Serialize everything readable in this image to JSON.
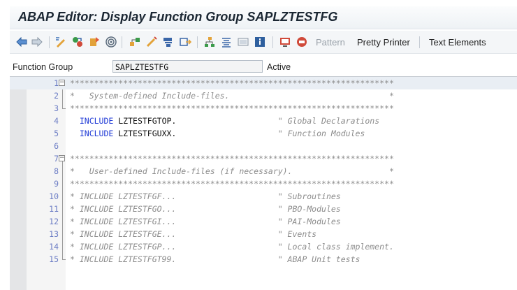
{
  "window": {
    "title": "ABAP Editor: Display Function Group SAPLZTESTFG"
  },
  "toolbar": {
    "icons": [
      "back-icon",
      "forward-icon",
      "other-object-icon",
      "display-change-icon",
      "activate-icon",
      "check-icon",
      "where-used-icon",
      "object-list-icon",
      "navigation-window-icon",
      "enhance-icon",
      "hierarchy-icon",
      "pretty-print-icon",
      "help-icon",
      "info-icon",
      "screen-icon",
      "test-icon"
    ],
    "pattern_label": "Pattern",
    "pretty_printer_label": "Pretty Printer",
    "text_elements_label": "Text Elements"
  },
  "header": {
    "field_label": "Function Group",
    "field_value": "SAPLZTESTFG",
    "status": "Active"
  },
  "editor": {
    "lines": [
      {
        "num": "1",
        "code": "*******************************************************************"
      },
      {
        "num": "2",
        "code": "*   System-defined Include-files.                                 *"
      },
      {
        "num": "3",
        "code": "*******************************************************************"
      },
      {
        "num": "4",
        "code": "  INCLUDE LZTESTFGTOP.                     \" Global Declarations"
      },
      {
        "num": "5",
        "code": "  INCLUDE LZTESTFGUXX.                     \" Function Modules"
      },
      {
        "num": "6",
        "code": ""
      },
      {
        "num": "7",
        "code": "*******************************************************************"
      },
      {
        "num": "8",
        "code": "*   User-defined Include-files (if necessary).                    *"
      },
      {
        "num": "9",
        "code": "*******************************************************************"
      },
      {
        "num": "10",
        "code": "* INCLUDE LZTESTFGF...                     \" Subroutines"
      },
      {
        "num": "11",
        "code": "* INCLUDE LZTESTFGO...                     \" PBO-Modules"
      },
      {
        "num": "12",
        "code": "* INCLUDE LZTESTFGI...                     \" PAI-Modules"
      },
      {
        "num": "13",
        "code": "* INCLUDE LZTESTFGE...                     \" Events"
      },
      {
        "num": "14",
        "code": "* INCLUDE LZTESTFGP...                     \" Local class implement."
      },
      {
        "num": "15",
        "code": "* INCLUDE LZTESTFGT99.                     \" ABAP Unit tests"
      }
    ]
  }
}
